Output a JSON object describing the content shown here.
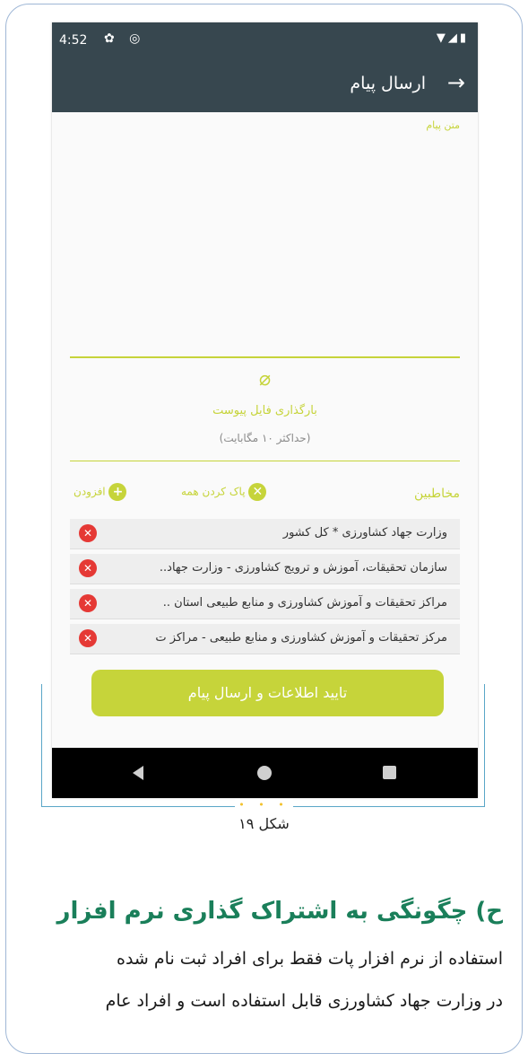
{
  "status_bar": {
    "time": "4:52",
    "left_icons": [
      "settings-icon",
      "at-sign-icon"
    ],
    "left_glyphs": "✿ ◎",
    "right_icons": [
      "wifi-icon",
      "signal-icon",
      "battery-icon"
    ],
    "right_glyphs": "▼◢▮"
  },
  "app_bar": {
    "title": "ارسال پیام",
    "back_glyph": "→"
  },
  "message": {
    "label": "متن پیام",
    "value": ""
  },
  "attachment": {
    "icon_glyph": "⌀",
    "label": "بارگذاری فایل پیوست",
    "note": "(حداکثر ۱۰ مگابایت)"
  },
  "recipients": {
    "label": "مخاطبین",
    "clear_all_label": "پاک کردن همه",
    "clear_all_glyph": "✕",
    "add_label": "افزودن",
    "add_glyph": "+",
    "remove_glyph": "✕",
    "items": [
      "وزارت جهاد کشاورزی * کل کشور",
      "سازمان تحقیقات، آموزش و ترویج کشاورزی - وزارت جهاد..",
      "مراکز تحقیقات و آموزش کشاورزی و منابع طبیعی استان ..",
      "مرکز تحقیقات و آموزش کشاورزی و منابع طبیعی - مراکز ت",
      ""
    ]
  },
  "submit": {
    "label": "تایید اطلاعات و ارسال پیام"
  },
  "nav": {
    "back": "back-icon",
    "home": "home-icon",
    "recents": "recents-icon"
  },
  "document": {
    "dots": "• • •",
    "figure_caption": "شکل ۱۹",
    "section_heading": "ح) چگونگی به اشتراک گذاری نرم افزار",
    "paragraph_line_1": "استفاده از نرم افزار پات فقط برای افراد ثبت نام شده",
    "paragraph_line_2": "در وزارت جهاد کشاورزی قابل استفاده است و افراد عام"
  },
  "colors": {
    "app_bar": "#37474f",
    "accent": "#c6d43a",
    "remove": "#e53935",
    "heading": "#1a7f5a",
    "frame": "#9fb7d6"
  }
}
